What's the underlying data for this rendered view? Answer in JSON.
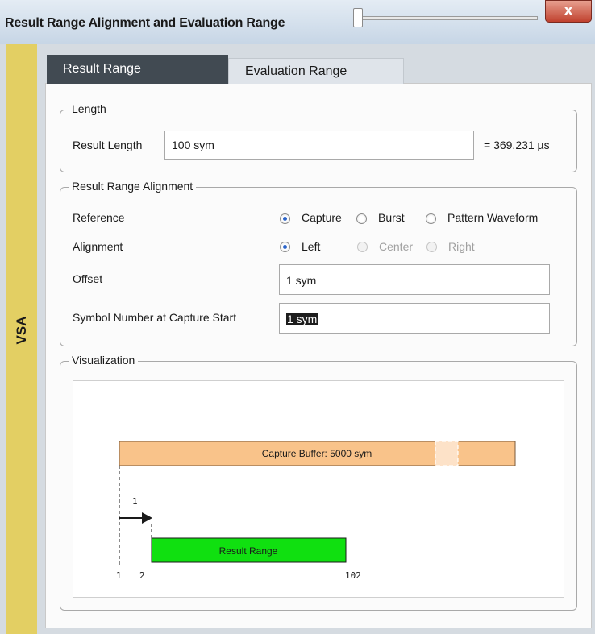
{
  "window": {
    "title": "Result Range Alignment and Evaluation Range",
    "close_label": "x",
    "side_label": "VSA"
  },
  "tabs": [
    {
      "label": "Result Range",
      "active": true
    },
    {
      "label": "Evaluation Range",
      "active": false
    }
  ],
  "length": {
    "legend": "Length",
    "result_length_label": "Result Length",
    "result_length_value": "100 sym",
    "result_length_time": "= 369.231 µs"
  },
  "alignment": {
    "legend": "Result Range Alignment",
    "reference_label": "Reference",
    "reference_options": [
      "Capture",
      "Burst",
      "Pattern Waveform"
    ],
    "reference_selected": "Capture",
    "alignment_label": "Alignment",
    "alignment_options": [
      "Left",
      "Center",
      "Right"
    ],
    "alignment_selected": "Left",
    "offset_label": "Offset",
    "offset_value": "1 sym",
    "symbol_start_label": "Symbol Number at Capture Start",
    "symbol_start_value": "1 sym"
  },
  "visualization": {
    "legend": "Visualization",
    "capture_buffer_label": "Capture Buffer: 5000 sym",
    "result_range_label": "Result Range",
    "offset_marker": "1",
    "tick_start": "1",
    "tick_result_start": "2",
    "tick_result_end": "102"
  },
  "colors": {
    "capture_buffer": "#f9c38a",
    "result_range": "#10e010",
    "tab_active": "#414a52",
    "side_strip": "#e3cf63",
    "radio_selected": "#2a63c8"
  }
}
